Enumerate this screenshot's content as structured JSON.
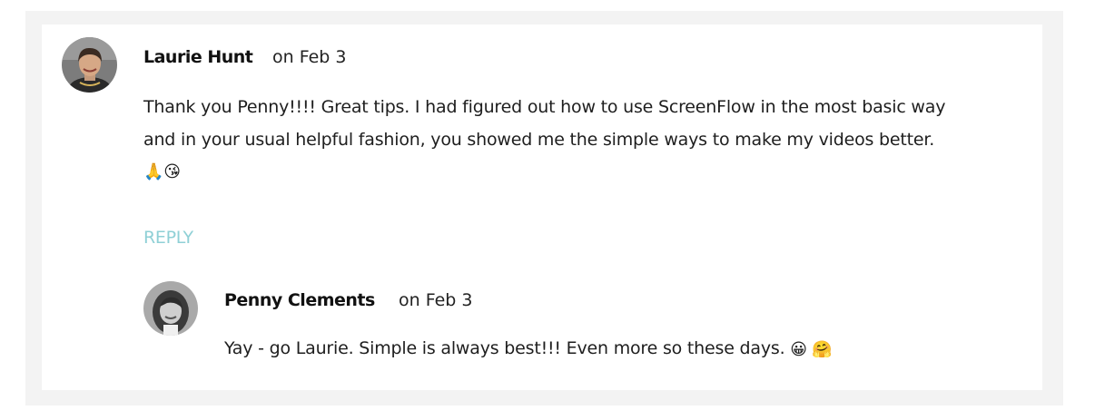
{
  "comment": {
    "author": "Laurie Hunt",
    "date": "on Feb 3",
    "text_line1": "Thank you Penny!!!! Great tips. I had figured out how to use ScreenFlow in the most basic way",
    "text_line2": "and in your usual helpful fashion, you showed me the simple ways to make my videos better.",
    "emojis": "🙏😘",
    "reply_label": "REPLY"
  },
  "reply_comment": {
    "author": "Penny Clements",
    "date": "on Feb 3",
    "text": "Yay - go Laurie. Simple is always best!!! Even more so these days.",
    "emojis": "😀 🤗"
  },
  "colors": {
    "reply_link": "#8fd0d6",
    "panel_background": "#f3f3f3",
    "card_background": "#ffffff"
  }
}
